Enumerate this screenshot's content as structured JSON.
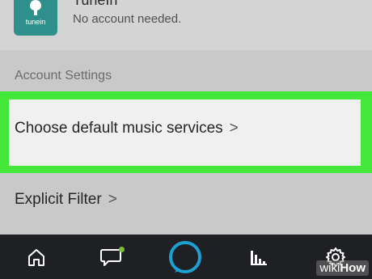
{
  "tunein": {
    "logo_text": "tunein",
    "name": "TuneIn",
    "subtitle": "No account needed."
  },
  "account_settings": {
    "header": "Account Settings",
    "items": [
      {
        "label": "Choose default music services",
        "chevron": ">"
      },
      {
        "label": "Explicit Filter",
        "chevron": ">"
      }
    ]
  },
  "nav": {
    "items": [
      {
        "icon": "home-icon"
      },
      {
        "icon": "chat-icon",
        "has_notification": true
      },
      {
        "icon": "alexa-ring-icon"
      },
      {
        "icon": "equalizer-icon"
      },
      {
        "icon": "gear-icon"
      }
    ]
  },
  "watermark": {
    "prefix": "wiki",
    "suffix": "How"
  },
  "colors": {
    "highlight_frame": "#44e83a",
    "accent": "#1da1d2",
    "nav_background": "#1f2024",
    "tunein_brand": "#2f8f8b",
    "notification": "#7dbf3a"
  }
}
